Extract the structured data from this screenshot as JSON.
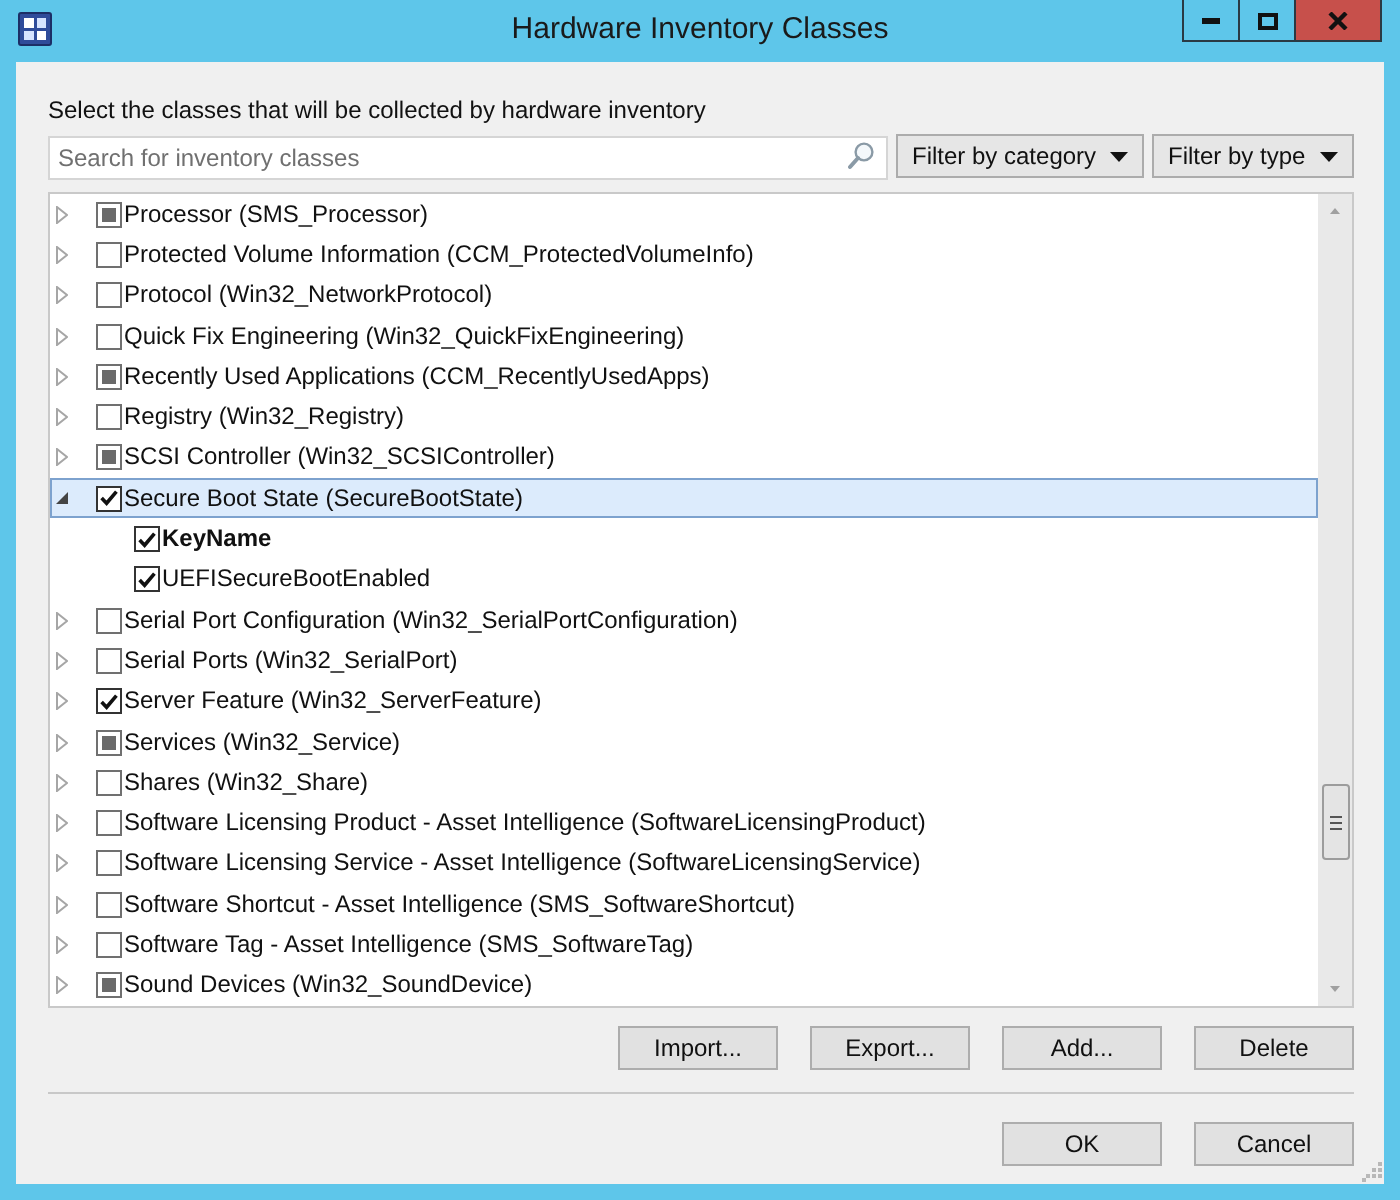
{
  "window": {
    "title": "Hardware Inventory Classes"
  },
  "instruction": "Select the classes that will be collected by hardware inventory",
  "search": {
    "placeholder": "Search for inventory classes"
  },
  "filters": [
    {
      "label": "Filter by category"
    },
    {
      "label": "Filter by type"
    }
  ],
  "classes": [
    {
      "label": "Processor (SMS_Processor)",
      "expanded": false,
      "checked": false,
      "partial": true,
      "selected": false
    },
    {
      "label": "Protected Volume Information (CCM_ProtectedVolumeInfo)",
      "expanded": false,
      "checked": false,
      "partial": false,
      "selected": false
    },
    {
      "label": "Protocol (Win32_NetworkProtocol)",
      "expanded": false,
      "checked": false,
      "partial": false,
      "selected": false
    },
    {
      "label": "Quick Fix Engineering (Win32_QuickFixEngineering)",
      "expanded": false,
      "checked": false,
      "partial": false,
      "selected": false
    },
    {
      "label": "Recently Used Applications (CCM_RecentlyUsedApps)",
      "expanded": false,
      "checked": false,
      "partial": true,
      "selected": false
    },
    {
      "label": "Registry (Win32_Registry)",
      "expanded": false,
      "checked": false,
      "partial": false,
      "selected": false
    },
    {
      "label": "SCSI Controller (Win32_SCSIController)",
      "expanded": false,
      "checked": false,
      "partial": true,
      "selected": false
    },
    {
      "label": "Secure Boot State (SecureBootState)",
      "expanded": true,
      "checked": true,
      "selected": true,
      "children": [
        {
          "label": "KeyName",
          "checked": true,
          "bold": true,
          "selected": false
        },
        {
          "label": "UEFISecureBootEnabled",
          "checked": true,
          "bold": false,
          "selected": false
        }
      ]
    },
    {
      "label": "Serial Port Configuration (Win32_SerialPortConfiguration)",
      "expanded": false,
      "checked": false,
      "partial": false,
      "selected": false
    },
    {
      "label": "Serial Ports (Win32_SerialPort)",
      "expanded": false,
      "checked": false,
      "partial": false,
      "selected": false
    },
    {
      "label": "Server Feature (Win32_ServerFeature)",
      "expanded": false,
      "checked": true,
      "selected": false
    },
    {
      "label": "Services (Win32_Service)",
      "expanded": false,
      "checked": false,
      "partial": true,
      "selected": false
    },
    {
      "label": "Shares (Win32_Share)",
      "expanded": false,
      "checked": false,
      "partial": false,
      "selected": false
    },
    {
      "label": "Software Licensing Product - Asset Intelligence (SoftwareLicensingProduct)",
      "expanded": false,
      "checked": false,
      "partial": false,
      "selected": false
    },
    {
      "label": "Software Licensing Service - Asset Intelligence (SoftwareLicensingService)",
      "expanded": false,
      "checked": false,
      "partial": false,
      "selected": false
    },
    {
      "label": "Software Shortcut - Asset Intelligence (SMS_SoftwareShortcut)",
      "expanded": false,
      "checked": false,
      "partial": false,
      "selected": false
    },
    {
      "label": "Software Tag - Asset Intelligence (SMS_SoftwareTag)",
      "expanded": false,
      "checked": false,
      "partial": false,
      "selected": false
    },
    {
      "label": "Sound Devices (Win32_SoundDevice)",
      "expanded": false,
      "checked": false,
      "partial": true,
      "selected": false
    }
  ],
  "list_buttons": [
    "Import...",
    "Export...",
    "Add...",
    "Delete"
  ],
  "dialog_buttons": [
    "OK",
    "Cancel"
  ]
}
